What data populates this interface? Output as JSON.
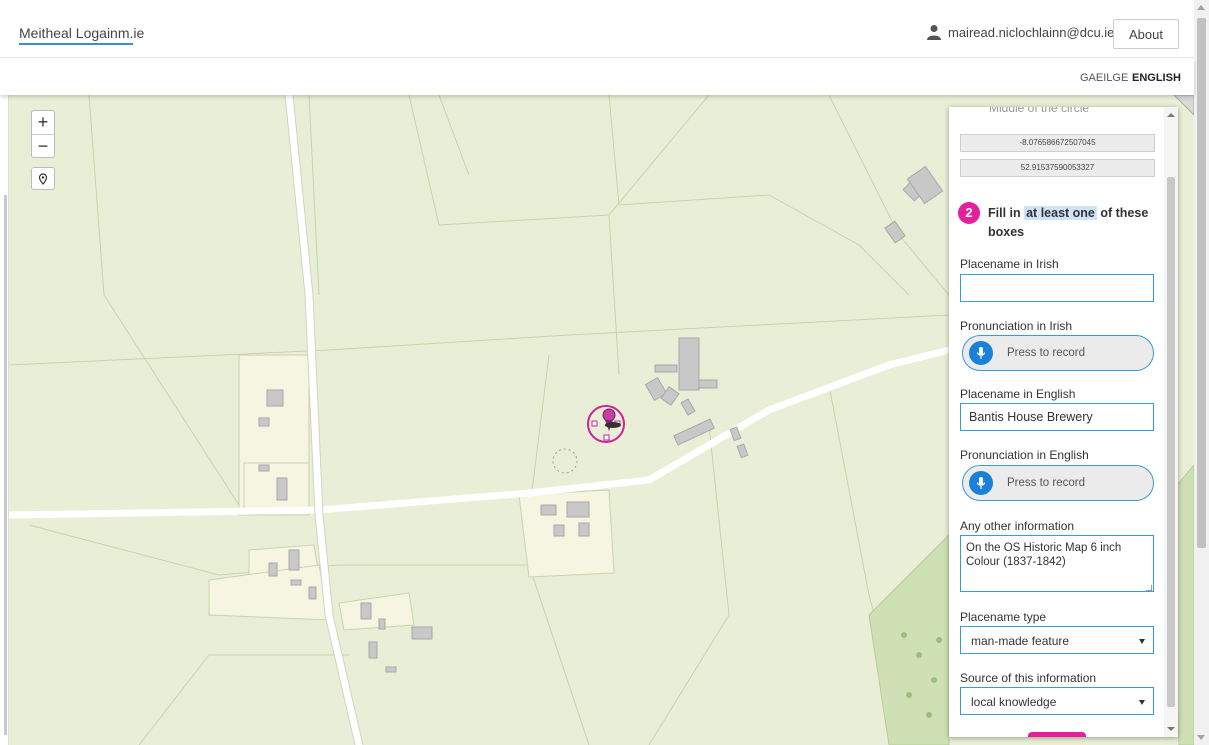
{
  "header": {
    "brand": "Meitheal Logainm.ie",
    "user_email": "mairead.niclochlainn@dcu.ie",
    "about_label": "About"
  },
  "languages": {
    "gaeilge": "GAEILGE",
    "english": "ENGLISH"
  },
  "map_controls": {
    "zoom_in": "+",
    "zoom_out": "−"
  },
  "panel": {
    "cutoff_text": "Middle of the circle",
    "longitude": "-8.076586672507045",
    "latitude": "52.91537590053327",
    "step_number": "2",
    "step_text_pre": "Fill in ",
    "step_text_highlight": "at least one",
    "step_text_post": " of these boxes",
    "placename_irish_label": "Placename in Irish",
    "placename_irish_value": "",
    "pron_irish_label": "Pronunciation in Irish",
    "press_to_record": "Press to record",
    "placename_english_label": "Placename in English",
    "placename_english_value": "Bantis House Brewery",
    "pron_english_label": "Pronunciation in English",
    "other_info_label": "Any other information",
    "other_info_value": "On the OS Historic Map 6 inch Colour (1837-1842)",
    "placename_type_label": "Placename type",
    "placename_type_value": "man-made feature",
    "source_label": "Source of this information",
    "source_value": "local knowledge"
  },
  "colors": {
    "accent_pink": "#e4209d",
    "accent_blue": "#3a9ad9",
    "map_bg": "#e9efd6"
  }
}
